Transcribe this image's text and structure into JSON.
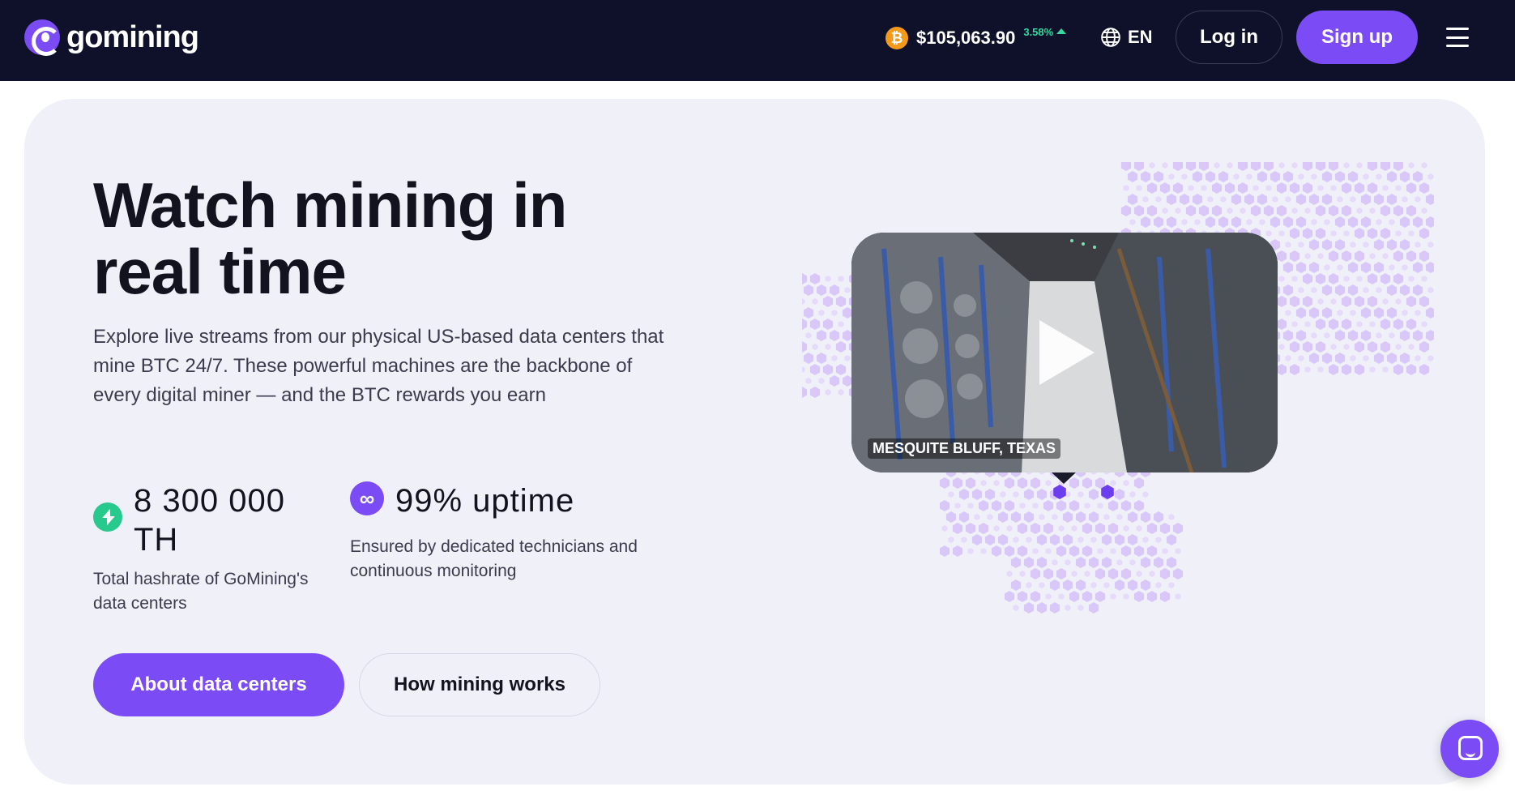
{
  "header": {
    "logo_text": "gomining",
    "btc_symbol": "₿",
    "btc_price": "$105,063.90",
    "btc_change": "3.58%",
    "language": "EN",
    "login_label": "Log in",
    "signup_label": "Sign up"
  },
  "hero": {
    "title": "Watch mining in real time",
    "description": "Explore live streams from our physical US-based data centers that mine BTC 24/7. These powerful machines are the backbone of every digital miner — and the BTC rewards you earn",
    "stats": [
      {
        "value": "8 300 000 TH",
        "label": "Total hashrate of GoMining's data centers"
      },
      {
        "value": "99% uptime",
        "label": "Ensured by dedicated technicians and continuous monitoring",
        "icon_glyph": "∞"
      }
    ],
    "buttons": {
      "primary": "About data centers",
      "secondary": "How mining works"
    }
  },
  "video": {
    "location_label": "MESQUITE BLUFF, TEXAS"
  },
  "colors": {
    "header_bg": "#0e1129",
    "accent": "#7b4cf5",
    "positive": "#33d9a0",
    "bitcoin": "#f39a1b",
    "hero_bg": "#f0f0f9"
  },
  "icons": [
    "gomining-logo-icon",
    "bitcoin-icon",
    "caret-up-icon",
    "globe-icon",
    "menu-icon",
    "bolt-icon",
    "infinity-icon",
    "play-icon",
    "chat-icon"
  ]
}
